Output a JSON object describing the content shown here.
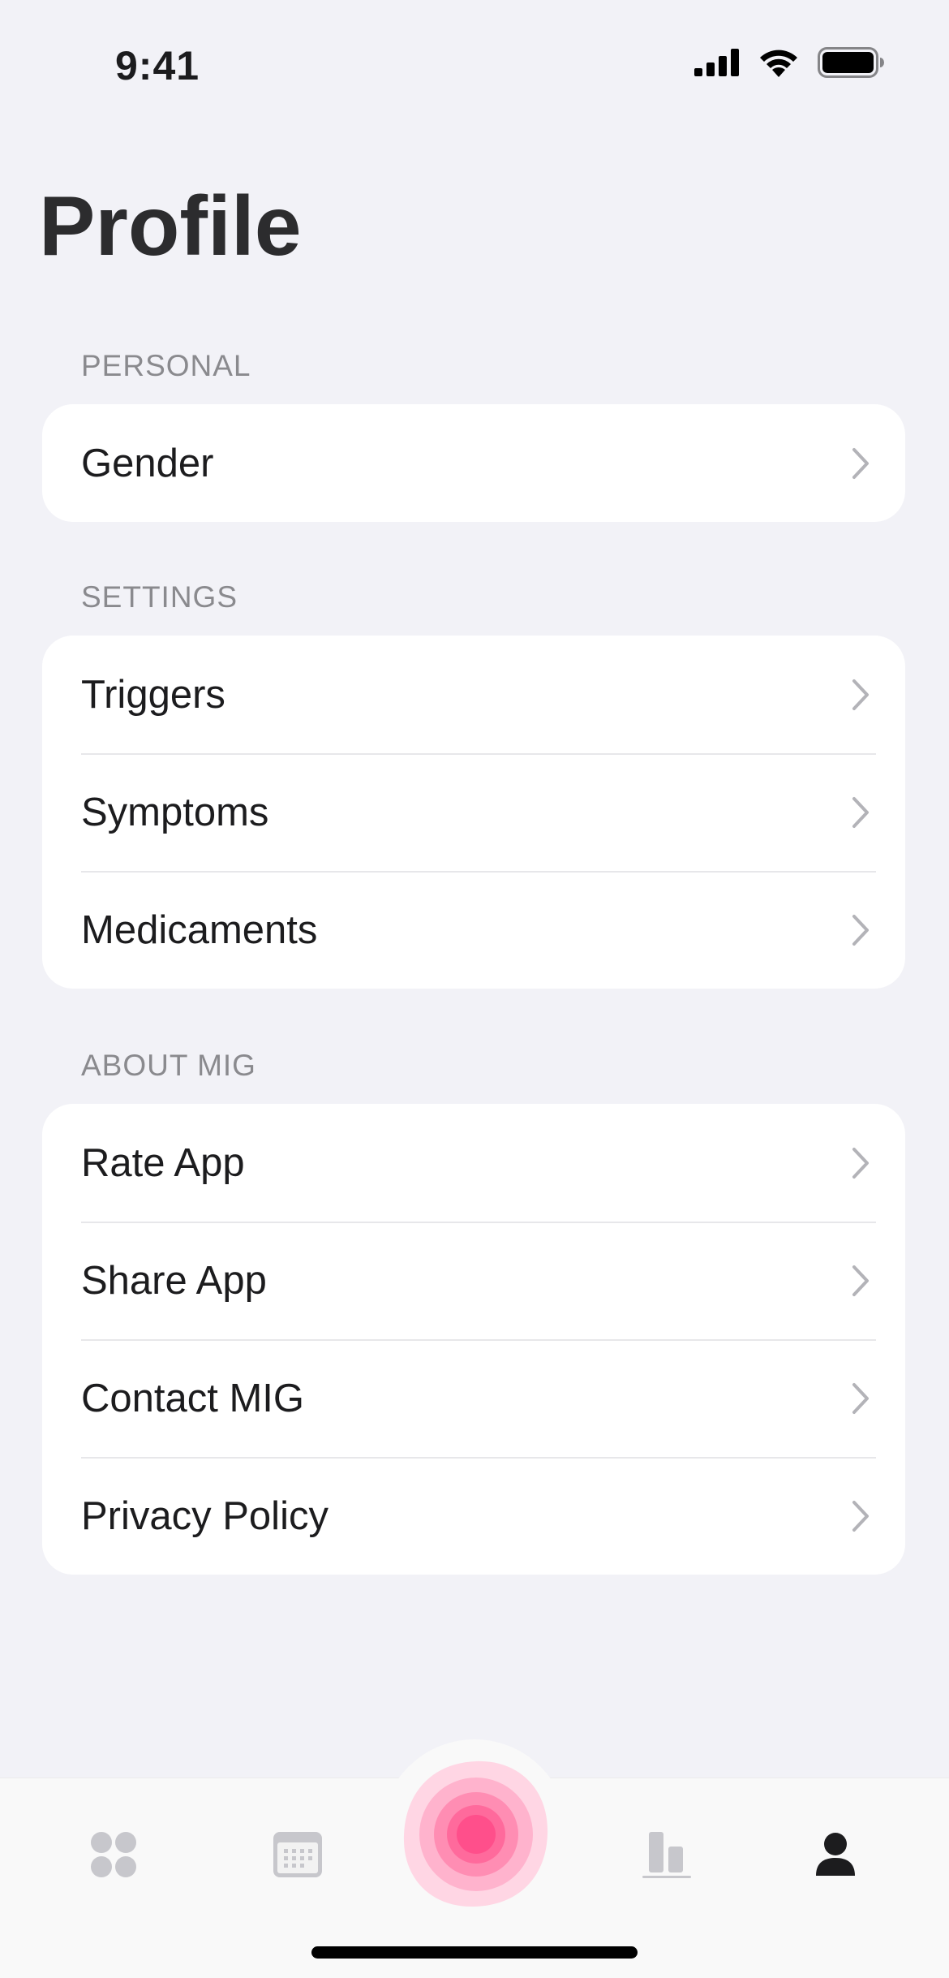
{
  "status_bar": {
    "time": "9:41"
  },
  "title": "Profile",
  "sections": [
    {
      "header": "PERSONAL",
      "items": [
        {
          "label": "Gender"
        }
      ]
    },
    {
      "header": "SETTINGS",
      "items": [
        {
          "label": "Triggers"
        },
        {
          "label": "Symptoms"
        },
        {
          "label": "Medicaments"
        }
      ]
    },
    {
      "header": "ABOUT MIG",
      "items": [
        {
          "label": "Rate App"
        },
        {
          "label": "Share App"
        },
        {
          "label": "Contact MIG"
        },
        {
          "label": "Privacy Policy"
        }
      ]
    }
  ],
  "tab_bar": {
    "tabs": [
      {
        "icon": "dashboard-icon",
        "active": false
      },
      {
        "icon": "calendar-icon",
        "active": false
      },
      {
        "icon": "log-attack-icon",
        "active": false
      },
      {
        "icon": "stats-icon",
        "active": false
      },
      {
        "icon": "profile-icon",
        "active": true
      }
    ],
    "colors": {
      "active": "#1c1c1e",
      "inactive": "#c7c7cc",
      "accent": "#ff4f8b"
    }
  }
}
